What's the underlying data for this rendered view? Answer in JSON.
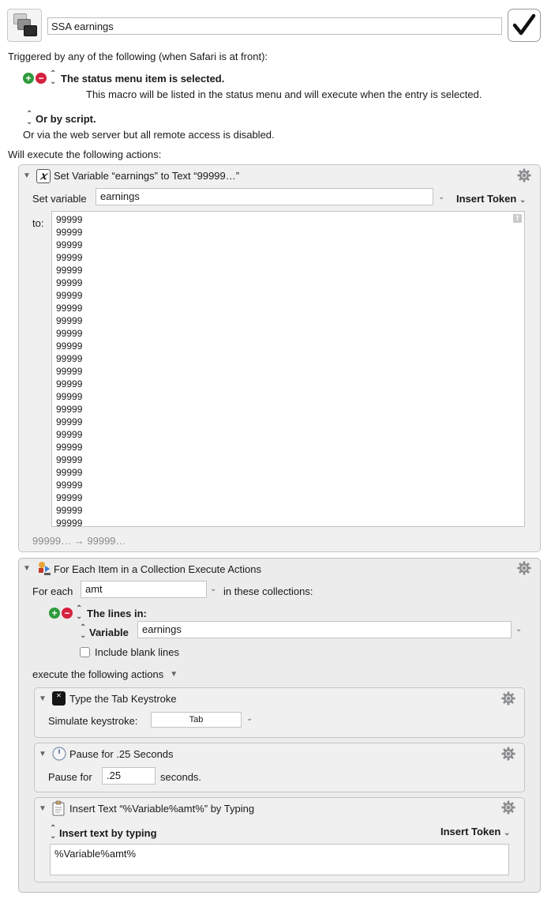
{
  "macro": {
    "name": "SSA earnings",
    "enabled": true,
    "icon": "macro-windows-icon"
  },
  "triggers": {
    "heading": "Triggered by any of the following (when Safari is at front):",
    "status_menu_trigger": "The status menu item is selected.",
    "status_menu_note": "This macro will be listed in the status menu and will execute when the entry is selected.",
    "script_trigger": "Or by script.",
    "web_server_note": "Or via the web server but all remote access is disabled."
  },
  "actions_heading": "Will execute the following actions:",
  "set_variable_action": {
    "title": "Set Variable “earnings” to Text “99999…”",
    "set_variable_label": "Set variable",
    "variable_name": "earnings",
    "insert_token_label": "Insert Token",
    "to_label": "to:",
    "text_lines": [
      "99999",
      "99999",
      "99999",
      "99999",
      "99999",
      "99999",
      "99999",
      "99999",
      "99999",
      "99999",
      "99999",
      "99999",
      "99999",
      "99999",
      "99999",
      "99999",
      "99999",
      "99999",
      "99999",
      "99999",
      "99999",
      "99999",
      "99999",
      "99999",
      "99999"
    ],
    "result_preview": "99999… → 99999…"
  },
  "for_each_action": {
    "title": "For Each Item in a Collection Execute Actions",
    "for_each_label": "For each",
    "loop_variable": "amt",
    "in_collections_label": "in these collections:",
    "collection_type": "The lines in:",
    "source_type": "Variable",
    "source_variable": "earnings",
    "include_blank_lines_label": "Include blank lines",
    "include_blank_lines": false,
    "execute_label": "execute the following actions",
    "sub_actions": {
      "type_keystroke": {
        "title": "Type the Tab Keystroke",
        "simulate_label": "Simulate keystroke:",
        "keystroke": "Tab"
      },
      "pause": {
        "title": "Pause for .25 Seconds",
        "pause_label": "Pause for",
        "seconds_value": ".25",
        "seconds_label": "seconds."
      },
      "insert_text": {
        "title": "Insert Text “%Variable%amt%” by Typing",
        "mode_label": "Insert text by typing",
        "insert_token_label": "Insert Token",
        "text": "%Variable%amt%"
      }
    }
  }
}
